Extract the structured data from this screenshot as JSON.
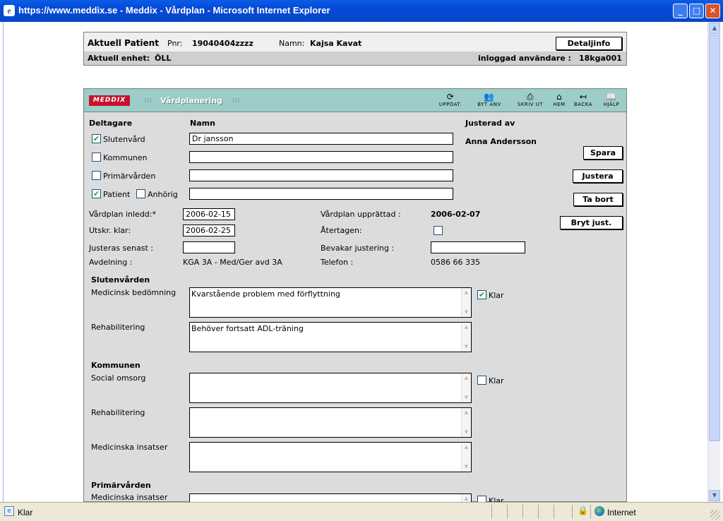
{
  "window": {
    "title": "https://www.meddix.se - Meddix - Vårdplan - Microsoft Internet Explorer",
    "ie_glyph": "e"
  },
  "patient": {
    "label": "Aktuell Patient",
    "pnr_label": "Pnr:",
    "pnr": "19040404zzzz",
    "namn_label": "Namn:",
    "namn": "Kajsa Kavat",
    "detail_button": "Detaljinfo",
    "unit_label": "Aktuell enhet:",
    "unit": "ÖLL",
    "user_label": "inloggad användare :",
    "user": "18kga001"
  },
  "header": {
    "logo": "MEDDIX",
    "title": "Vårdplanering",
    "tools": [
      {
        "label": "UPPDAT.",
        "icon": "refresh-icon"
      },
      {
        "label": "BYT ANV",
        "icon": "switch-user-icon"
      },
      {
        "label": "SKRIV UT",
        "icon": "print-icon"
      },
      {
        "label": "HEM",
        "icon": "home-icon"
      },
      {
        "label": "BACKA",
        "icon": "back-icon"
      },
      {
        "label": "HJÄLP",
        "icon": "help-icon"
      }
    ]
  },
  "form": {
    "col_deltagare": "Deltagare",
    "col_namn": "Namn",
    "col_justerad": "Justerad av",
    "justerad_namn": "Anna Andersson",
    "participants": [
      {
        "label": "Slutenvård",
        "checked": true,
        "name": "Dr jansson"
      },
      {
        "label": "Kommunen",
        "checked": false,
        "name": ""
      },
      {
        "label": "Primärvården",
        "checked": false,
        "name": ""
      },
      {
        "label": "Patient",
        "checked": true,
        "name": ""
      }
    ],
    "anhorig": {
      "label": "Anhörig",
      "checked": false
    },
    "vardplan_inledd_label": "Vårdplan inledd:*",
    "vardplan_inledd": "2006-02-15",
    "utskr_klar_label": "Utskr. klar:",
    "utskr_klar": "2006-02-25",
    "justeras_senast_label": "Justeras senast :",
    "justeras_senast": "",
    "avdelning_label": "Avdelning :",
    "avdelning": "KGA 3A - Med/Ger avd 3A",
    "upprattad_label": "Vårdplan upprättad :",
    "upprattad": "2006-02-07",
    "atertagen_label": "Återtagen:",
    "bevakar_label": "Bevakar justering :",
    "bevakar": "",
    "telefon_label": "Telefon :",
    "telefon": "0586 66 335"
  },
  "actions": {
    "spara": "Spara",
    "justera": "Justera",
    "ta_bort": "Ta bort",
    "bryt": "Bryt just."
  },
  "sections": {
    "slutenvarden": {
      "title": "Slutenvården",
      "f1_label": "Medicinsk bedömning",
      "f1_text": "Kvarstående problem med förflyttning",
      "f2_label": "Rehabilitering",
      "f2_text": "Behöver fortsatt ADL-träning",
      "klar": "Klar",
      "klar_checked": true
    },
    "kommunen": {
      "title": "Kommunen",
      "f1_label": "Social omsorg",
      "f1_text": "",
      "f2_label": "Rehabilitering",
      "f2_text": "",
      "f3_label": "Medicinska insatser",
      "f3_text": "",
      "klar": "Klar",
      "klar_checked": false
    },
    "primarvarden": {
      "title": "Primärvården",
      "f1_label": "Medicinska insatser",
      "klar": "Klar",
      "klar_checked": false
    }
  },
  "status": {
    "left": "Klar",
    "zone": "Internet"
  }
}
